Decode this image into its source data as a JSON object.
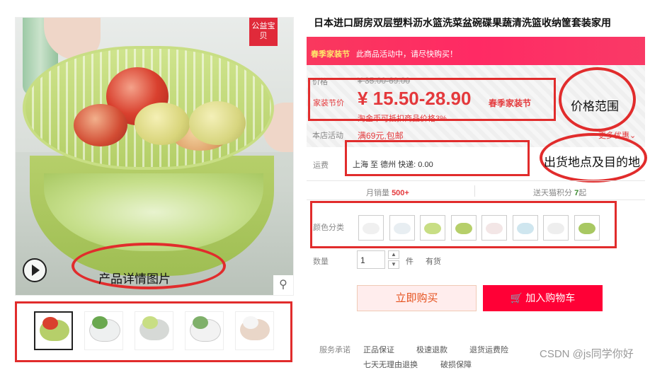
{
  "product": {
    "title": "日本进口厨房双层塑料沥水篮洗菜盆碗碟果蔬清洗篮收纳筐套装家用",
    "badge": "公益宝贝"
  },
  "banner": {
    "tag": "春季家装节",
    "text": "此商品活动中，请尽快购买！"
  },
  "price": {
    "label": "价格",
    "old_price": "¥ 35.00-69.00",
    "promo_label": "家装节价",
    "current": "¥ 15.50-28.90",
    "promo_badge": "春季家装节",
    "tmall_text": "淘金币可抵扣商品价格3%",
    "store_label": "本店活动",
    "store_promo": "满69元,包邮",
    "more_deals": "更多优惠"
  },
  "shipping": {
    "label": "运费",
    "text": "上海  至  德州  快递: 0.00"
  },
  "stats": {
    "monthly_sales_label": "月销量",
    "monthly_sales": "500+",
    "points_label": "送天猫积分",
    "points_value": "7",
    "points_suffix": "起"
  },
  "color": {
    "label": "颜色分类",
    "swatches": [
      "#f0f0f0",
      "#e8eef2",
      "#c8de84",
      "#b6cf6a",
      "#f3e6e6",
      "#cfe6ef",
      "#eeeeee",
      "#a8c862"
    ]
  },
  "quantity": {
    "label": "数量",
    "value": "1",
    "unit": "件",
    "stock": "有货"
  },
  "buttons": {
    "buy_now": "立即购买",
    "add_cart": "加入购物车"
  },
  "services": {
    "label": "服务承诺",
    "items": [
      "正品保证",
      "极速退款",
      "退货运费险",
      "七天无理由退换",
      "破损保障"
    ]
  },
  "annotations": {
    "image_label": "产品详情图片",
    "price_label": "价格范围",
    "ship_label": "出货地点及目的地"
  },
  "watermark": "CSDN @js同学你好",
  "colors": {
    "accent": "#e4393c",
    "cart_red": "#ff0036",
    "annotation_red": "#e12c2c"
  }
}
